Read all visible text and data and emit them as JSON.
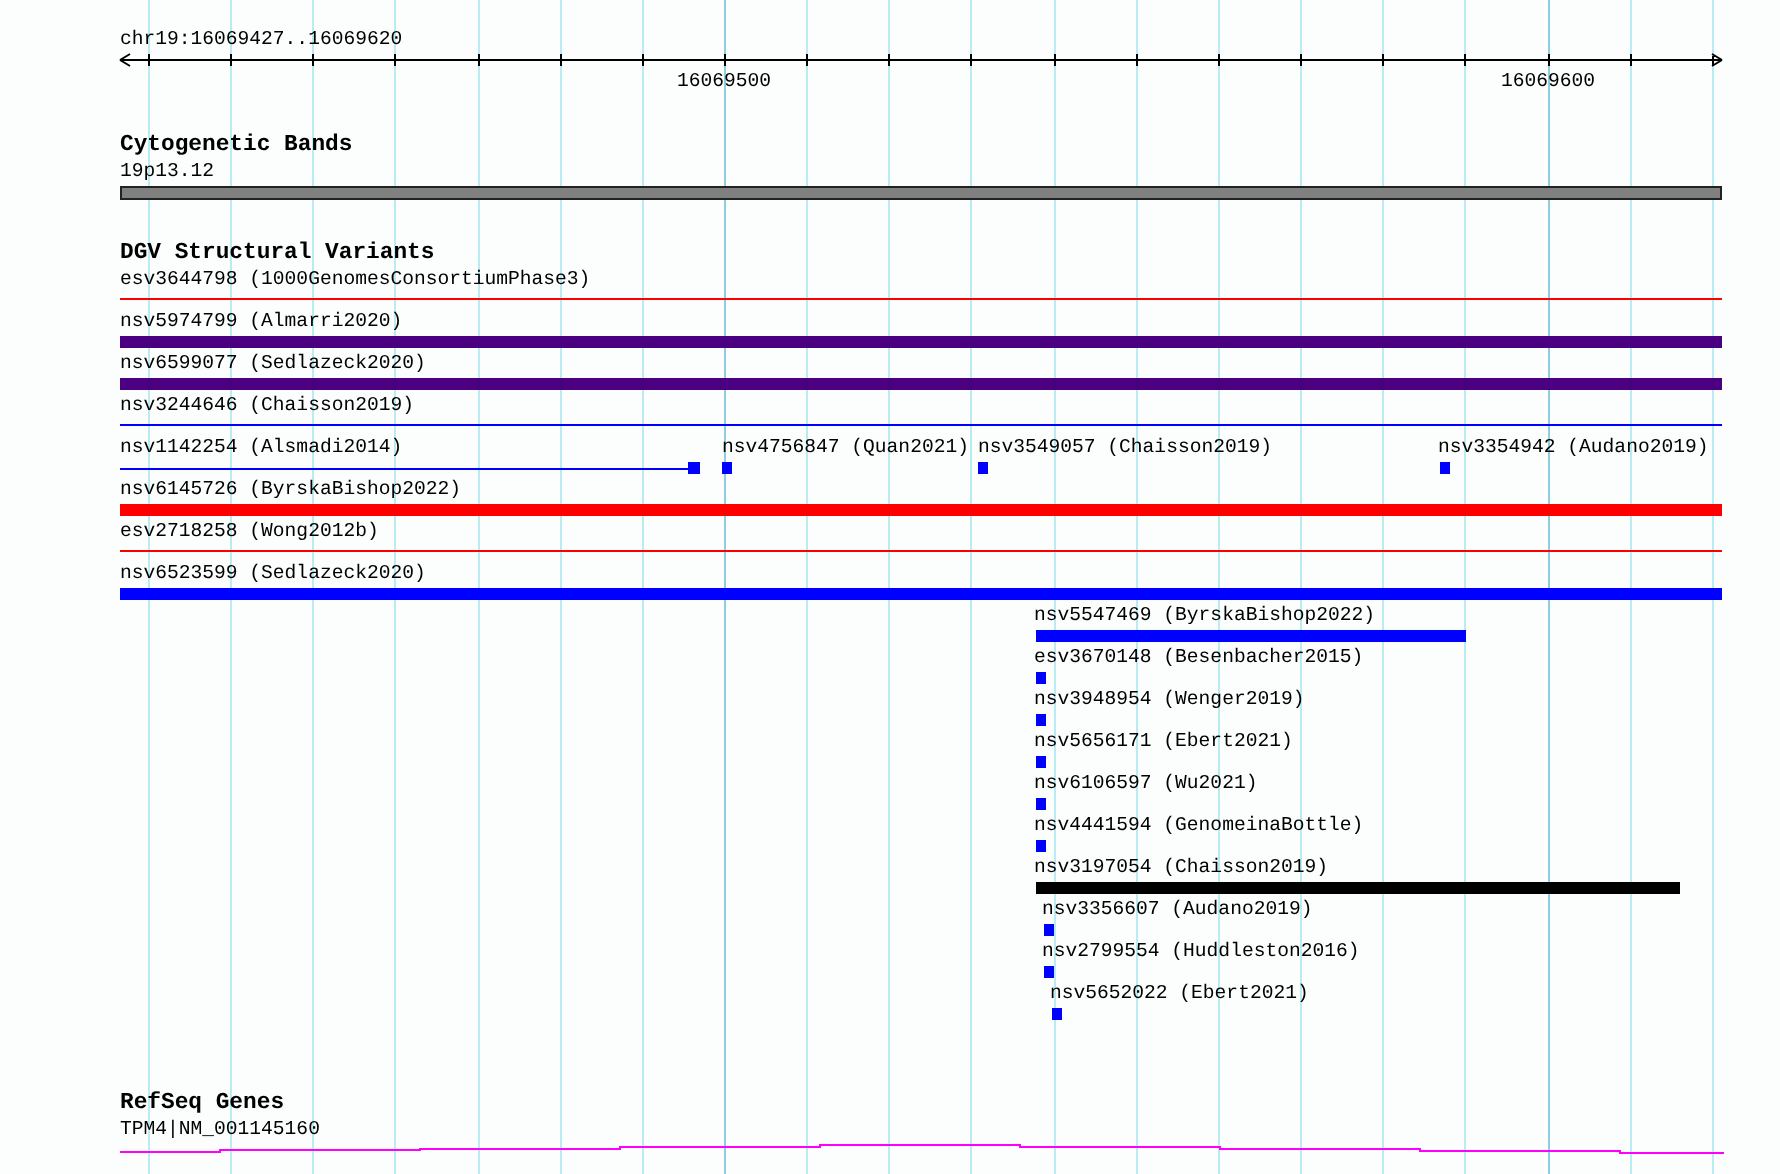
{
  "ruler": {
    "location": "chr19:16069427..16069620",
    "ticks": [
      "16069500",
      "16069600"
    ]
  },
  "cytogenetic_bands": {
    "title": "Cytogenetic Bands",
    "bands": [
      {
        "label": "19p13.12"
      }
    ]
  },
  "dgv": {
    "title": "DGV Structural Variants",
    "rows": [
      {
        "features": [
          {
            "label": "esv3644798 (1000GenomesConsortiumPhase3)",
            "kind": "line",
            "color": "#ff0000"
          }
        ]
      },
      {
        "features": [
          {
            "label": "nsv5974799 (Almarri2020)",
            "kind": "bar",
            "color": "#4b0082"
          }
        ]
      },
      {
        "features": [
          {
            "label": "nsv6599077 (Sedlazeck2020)",
            "kind": "bar",
            "color": "#4b0082"
          }
        ]
      },
      {
        "features": [
          {
            "label": "nsv3244646 (Chaisson2019)",
            "kind": "line",
            "color": "#0000ff"
          }
        ]
      },
      {
        "features": [
          {
            "label": "nsv1142254 (Alsmadi2014)",
            "kind": "capped-line",
            "color": "#0000ff"
          },
          {
            "label": "nsv4756847 (Quan2021)",
            "kind": "point",
            "color": "#0000ff"
          },
          {
            "label": "nsv3549057 (Chaisson2019)",
            "kind": "point",
            "color": "#0000ff"
          },
          {
            "label": "nsv3354942 (Audano2019)",
            "kind": "point",
            "color": "#0000ff"
          }
        ]
      },
      {
        "features": [
          {
            "label": "nsv6145726 (ByrskaBishop2022)",
            "kind": "bar",
            "color": "#ff0000"
          }
        ]
      },
      {
        "features": [
          {
            "label": "esv2718258 (Wong2012b)",
            "kind": "line",
            "color": "#ff0000"
          }
        ]
      },
      {
        "features": [
          {
            "label": "nsv6523599 (Sedlazeck2020)",
            "kind": "bar",
            "color": "#0000ff"
          }
        ]
      },
      {
        "features": [
          {
            "label": "nsv5547469 (ByrskaBishop2022)",
            "kind": "bar",
            "color": "#0000ff"
          }
        ]
      },
      {
        "features": [
          {
            "label": "esv3670148 (Besenbacher2015)",
            "kind": "point",
            "color": "#0000ff"
          }
        ]
      },
      {
        "features": [
          {
            "label": "nsv3948954 (Wenger2019)",
            "kind": "point",
            "color": "#0000ff"
          }
        ]
      },
      {
        "features": [
          {
            "label": "nsv5656171 (Ebert2021)",
            "kind": "point",
            "color": "#0000ff"
          }
        ]
      },
      {
        "features": [
          {
            "label": "nsv6106597 (Wu2021)",
            "kind": "point",
            "color": "#0000ff"
          }
        ]
      },
      {
        "features": [
          {
            "label": "nsv4441594 (GenomeinaBottle)",
            "kind": "point",
            "color": "#0000ff"
          }
        ]
      },
      {
        "features": [
          {
            "label": "nsv3197054 (Chaisson2019)",
            "kind": "bar",
            "color": "#000000"
          }
        ]
      },
      {
        "features": [
          {
            "label": "nsv3356607 (Audano2019)",
            "kind": "point",
            "color": "#0000ff"
          }
        ]
      },
      {
        "features": [
          {
            "label": "nsv2799554 (Huddleston2016)",
            "kind": "point",
            "color": "#0000ff"
          }
        ]
      },
      {
        "features": [
          {
            "label": "nsv5652022 (Ebert2021)",
            "kind": "point",
            "color": "#0000ff"
          }
        ]
      }
    ]
  },
  "refseq_genes": {
    "title": "RefSeq Genes",
    "genes": [
      {
        "label": "TPM4|NM_001145160"
      }
    ]
  }
}
